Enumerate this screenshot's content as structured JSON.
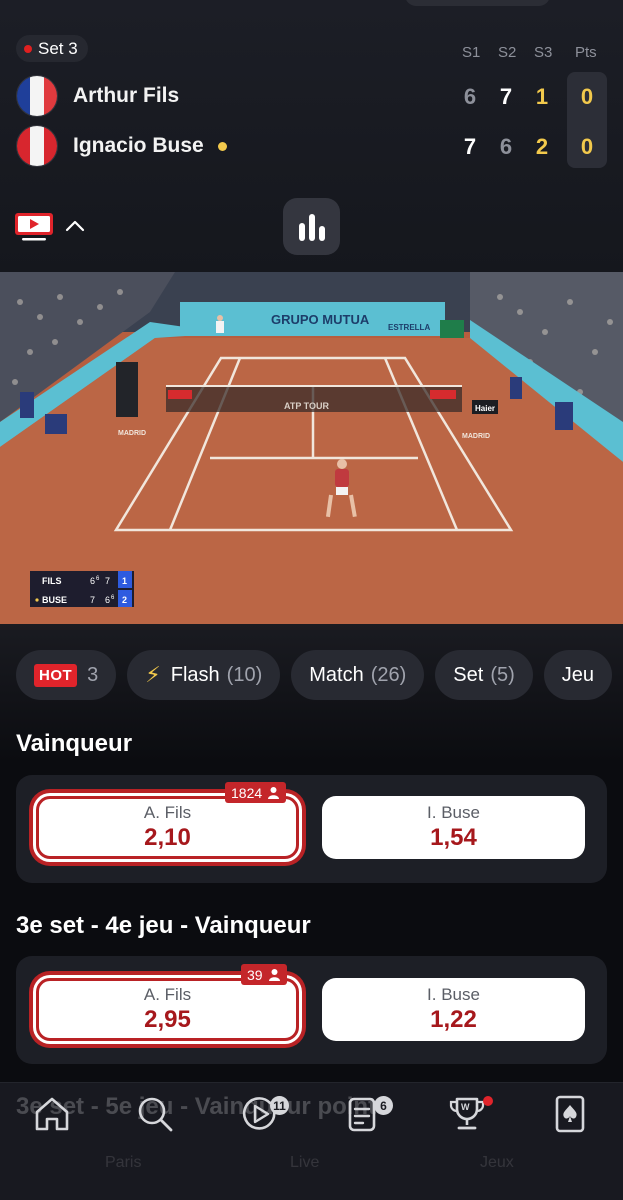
{
  "scoreboard": {
    "set_label": "Set 3",
    "columns": [
      "S1",
      "S2",
      "S3",
      "Pts"
    ],
    "players": [
      {
        "name": "Arthur Fils",
        "scores": [
          "6",
          "7",
          "1"
        ],
        "points": "0",
        "serving": false
      },
      {
        "name": "Ignacio Buse",
        "scores": [
          "7",
          "6",
          "2"
        ],
        "points": "0",
        "serving": true
      }
    ]
  },
  "video_overlay": {
    "rows": [
      {
        "name": "FILS",
        "s1": "6",
        "s1_sup": "6",
        "s2": "7",
        "s3": "1"
      },
      {
        "name": "BUSE",
        "s1": "7",
        "s2": "6",
        "s2_sup": "6",
        "s3": "2"
      }
    ],
    "banner_text": "GRUPO MUTUA",
    "side_text": "ESTRELLA",
    "net_text": "ATP TOUR",
    "board_text": "Haier",
    "court_text_left": "MADRID",
    "court_text_right": "MADRID"
  },
  "filters": [
    {
      "badge": "HOT",
      "label": "",
      "count": "3"
    },
    {
      "icon": "lightning-icon",
      "label": "Flash",
      "count": "(10)"
    },
    {
      "label": "Match",
      "count": "(26)"
    },
    {
      "label": "Set",
      "count": "(5)"
    },
    {
      "label": "Jeu",
      "count": ""
    }
  ],
  "markets": [
    {
      "title": "Vainqueur",
      "bettors": "1824",
      "options": [
        {
          "name": "A. Fils",
          "odd": "2,10",
          "selected": true
        },
        {
          "name": "I. Buse",
          "odd": "1,54",
          "selected": false
        }
      ]
    },
    {
      "title": "3e set - 4e jeu - Vainqueur",
      "bettors": "39",
      "options": [
        {
          "name": "A. Fils",
          "odd": "2,95",
          "selected": true
        },
        {
          "name": "I. Buse",
          "odd": "1,22",
          "selected": false
        }
      ]
    }
  ],
  "ghost": {
    "next_title": "3e set - 5e jeu - Vainqueur point",
    "labels": [
      "Paris",
      "Live",
      "Jeux"
    ]
  },
  "nav": {
    "items": [
      "home-icon",
      "search-icon",
      "live-icon",
      "bets-icon",
      "trophy-icon",
      "casino-icon"
    ],
    "live_badge": "11",
    "bets_badge": "6"
  },
  "colors": {
    "accent_red": "#c4262a",
    "serve_yellow": "#f2c94c",
    "background": "#0b0c10"
  }
}
